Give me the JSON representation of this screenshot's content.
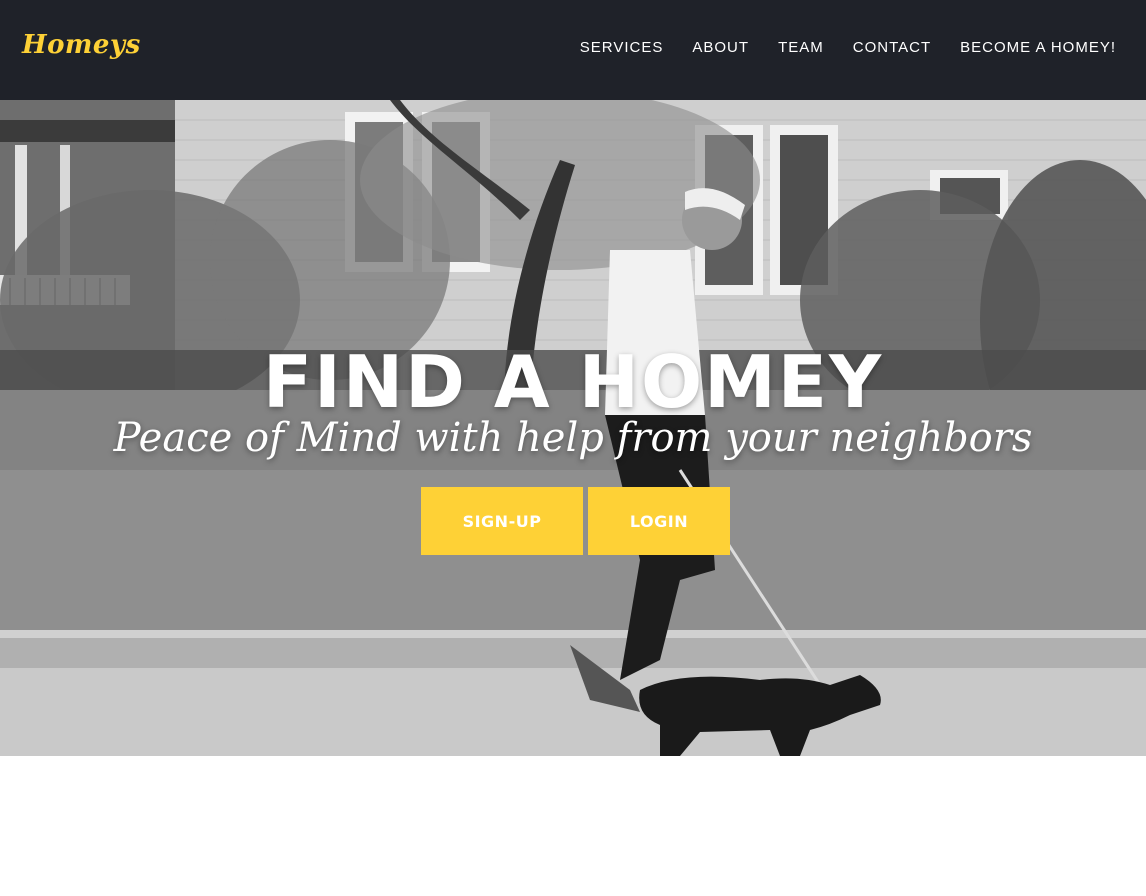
{
  "brand": {
    "name": "Homeys",
    "color": "#fed136"
  },
  "nav": {
    "items": [
      "Services",
      "About",
      "Team",
      "Contact",
      "Become a Homey!"
    ]
  },
  "hero": {
    "heading": "FIND A HOMEY",
    "subheading": "Peace of Mind with help from your neighbors",
    "signup_label": "Sign-Up",
    "login_label": "Login",
    "image": "black-and-white photo of an elderly man walking a dachshund past a house"
  },
  "colors": {
    "navbar": "#1f2229",
    "accent": "#fed136",
    "text": "#ffffff"
  }
}
